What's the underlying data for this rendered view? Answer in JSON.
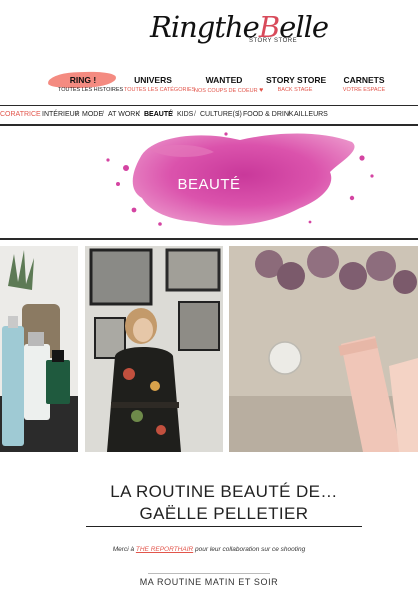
{
  "header": {
    "logo_text_a": "Ringthe",
    "logo_text_b": "B",
    "logo_text_c": "elle",
    "logo_tagline": "STORY STORE"
  },
  "main_nav": [
    {
      "title": "RING !",
      "subtitle": "TOUTES LES HISTOIRES"
    },
    {
      "title": "UNIVERS",
      "subtitle": "TOUTES LES CATÉGORIES"
    },
    {
      "title": "WANTED",
      "subtitle": "NOS COUPS DE COEUR"
    },
    {
      "title": "STORY STORE",
      "subtitle": "BACK STAGE"
    },
    {
      "title": "CARNETS",
      "subtitle": "VOTRE ESPACE"
    }
  ],
  "sub_nav": {
    "cut_item": "CORATRICE",
    "items": [
      "INTÉRIEUR",
      "MODE",
      "AT WORK",
      "BEAUTÉ",
      "KIDS",
      "CULTURE(S)",
      "FOOD & DRINK",
      "AILLEURS"
    ],
    "separator": "/",
    "active": "BEAUTÉ"
  },
  "banner": {
    "title": "BEAUTÉ"
  },
  "article": {
    "title_line1": "LA ROUTINE BEAUTÉ DE…",
    "title_line2": "GAËLLE PELLETIER",
    "credit_before": "Merci à ",
    "credit_link": "THE REPORTHAIR",
    "credit_after": " pour leur collaboration sur ce shooting",
    "subhead": "MA ROUTINE MATIN ET SOIR"
  },
  "colors": {
    "accent": "#e2554b",
    "banner_splash": "#d63aa0",
    "rule": "#2a2a2a"
  }
}
